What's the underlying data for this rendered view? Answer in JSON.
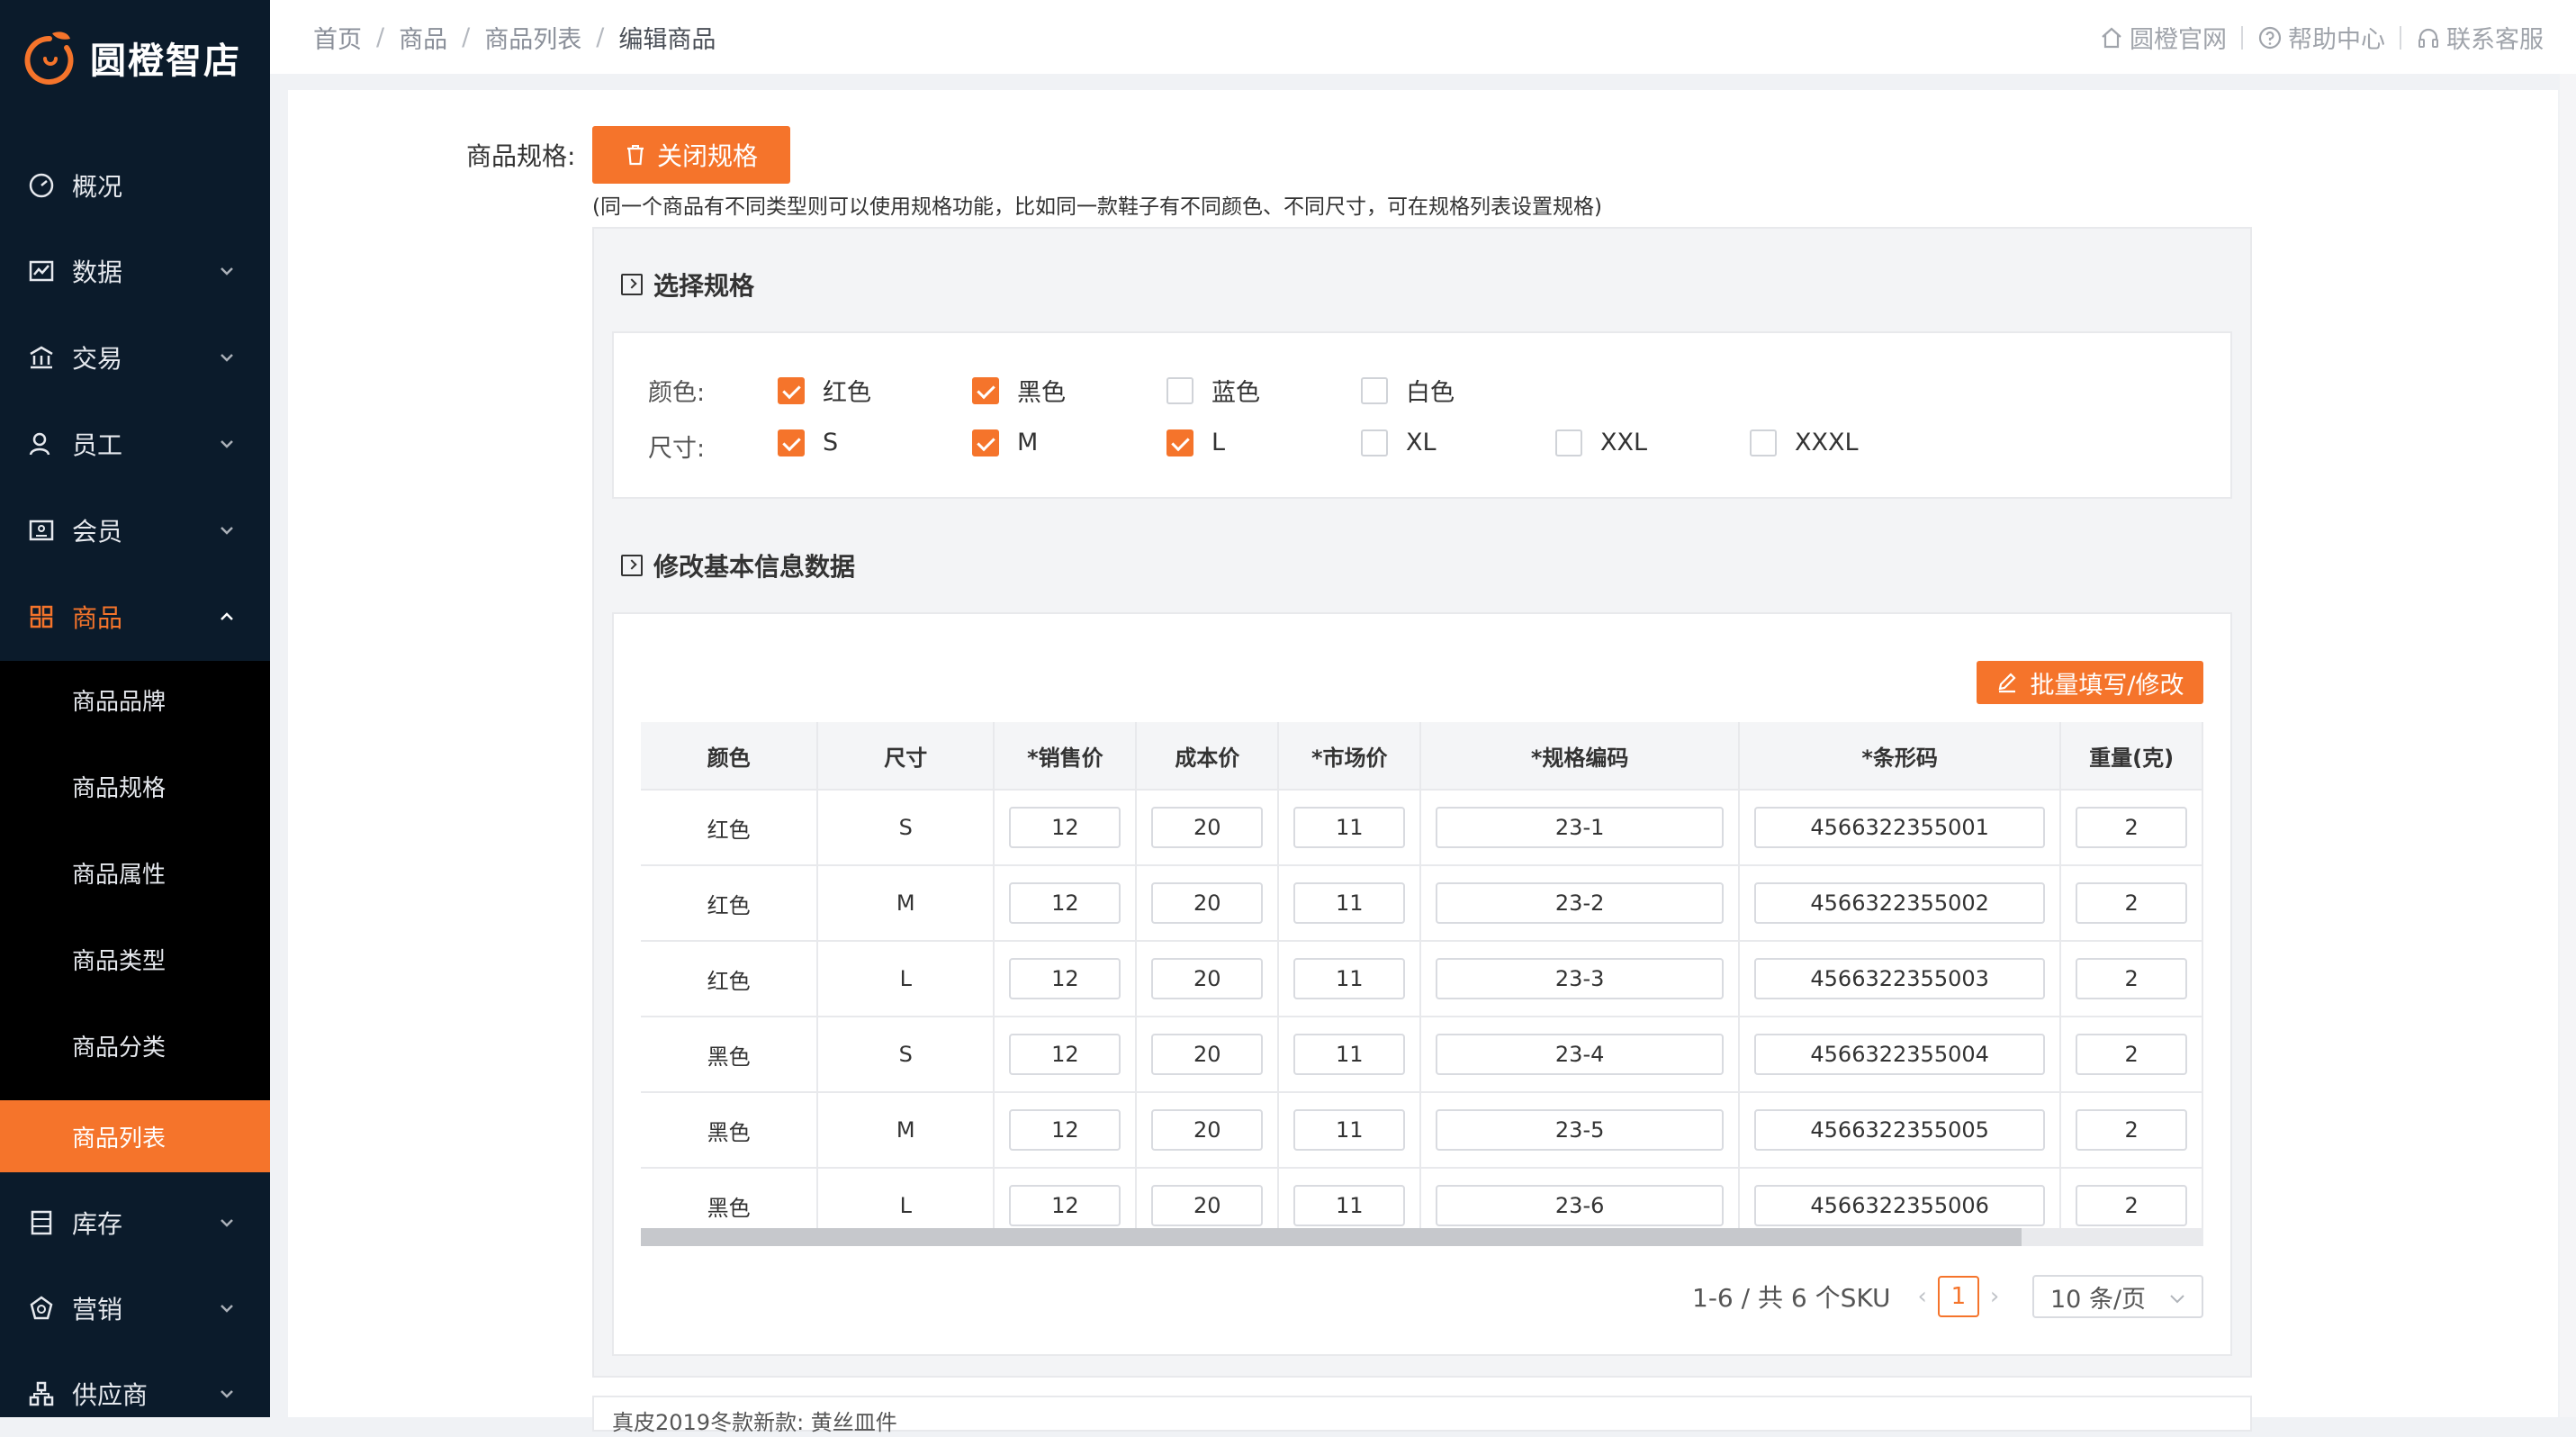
{
  "brand": {
    "name": "圆橙智店",
    "accent": "#f5742b"
  },
  "breadcrumb": [
    "首页",
    "商品",
    "商品列表",
    "编辑商品"
  ],
  "header_links": [
    {
      "label": "圆橙官网",
      "icon": "home-icon"
    },
    {
      "label": "帮助中心",
      "icon": "help-icon"
    },
    {
      "label": "联系客服",
      "icon": "headset-icon"
    }
  ],
  "sidebar": {
    "items": [
      {
        "label": "概况",
        "icon": "dashboard-icon"
      },
      {
        "label": "数据",
        "icon": "chart-icon"
      },
      {
        "label": "交易",
        "icon": "bank-icon"
      },
      {
        "label": "员工",
        "icon": "user-icon"
      },
      {
        "label": "会员",
        "icon": "member-card-icon"
      },
      {
        "label": "商品",
        "icon": "grid-icon"
      },
      {
        "label": "库存",
        "icon": "inventory-icon"
      },
      {
        "label": "营销",
        "icon": "marketing-icon"
      },
      {
        "label": "供应商",
        "icon": "supplier-icon"
      }
    ],
    "sub_items": [
      "商品品牌",
      "商品规格",
      "商品属性",
      "商品类型",
      "商品分类",
      "商品列表"
    ]
  },
  "spec": {
    "label": "商品规格:",
    "close_button": "关闭规格",
    "help": "(同一个商品有不同类型则可以使用规格功能，比如同一款鞋子有不同颜色、不同尺寸，可在规格列表设置规格)",
    "select_title": "选择规格",
    "color_label": "颜色:",
    "size_label": "尺寸:",
    "colors": [
      {
        "label": "红色",
        "checked": true
      },
      {
        "label": "黑色",
        "checked": true
      },
      {
        "label": "蓝色",
        "checked": false
      },
      {
        "label": "白色",
        "checked": false
      }
    ],
    "sizes": [
      {
        "label": "S",
        "checked": true
      },
      {
        "label": "M",
        "checked": true
      },
      {
        "label": "L",
        "checked": true
      },
      {
        "label": "XL",
        "checked": false
      },
      {
        "label": "XXL",
        "checked": false
      },
      {
        "label": "XXXL",
        "checked": false
      }
    ],
    "edit_title": "修改基本信息数据",
    "batch_button": "批量填写/修改"
  },
  "table": {
    "headers": [
      "颜色",
      "尺寸",
      "*销售价",
      "成本价",
      "*市场价",
      "*规格编码",
      "*条形码",
      "重量(克)"
    ],
    "rows": [
      [
        "红色",
        "S",
        "12",
        "20",
        "11",
        "23-1",
        "4566322355001",
        "2"
      ],
      [
        "红色",
        "M",
        "12",
        "20",
        "11",
        "23-2",
        "4566322355002",
        "2"
      ],
      [
        "红色",
        "L",
        "12",
        "20",
        "11",
        "23-3",
        "4566322355003",
        "2"
      ],
      [
        "黑色",
        "S",
        "12",
        "20",
        "11",
        "23-4",
        "4566322355004",
        "2"
      ],
      [
        "黑色",
        "M",
        "12",
        "20",
        "11",
        "23-5",
        "4566322355005",
        "2"
      ],
      [
        "黑色",
        "L",
        "12",
        "20",
        "11",
        "23-6",
        "4566322355006",
        "2"
      ]
    ]
  },
  "pagination": {
    "summary": "1-6 / 共 6 个SKU",
    "current": "1",
    "page_size": "10 条/页"
  },
  "bottom_text": "真皮2019冬款新款: 黄丝皿件"
}
